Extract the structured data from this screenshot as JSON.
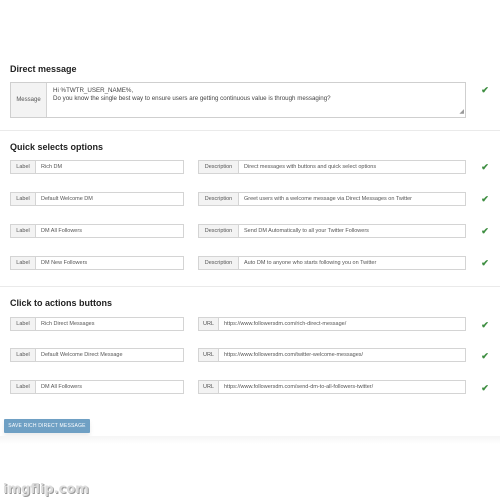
{
  "direct_message": {
    "title": "Direct message",
    "addon": "Message",
    "line1": "Hi %TWTR_USER_NAME%,",
    "line2": "Do you know the single best way to ensure users are getting continuous value is through messaging?"
  },
  "quick_selects": {
    "title": "Quick selects options",
    "label_addon": "Label",
    "description_addon": "Description",
    "rows": [
      {
        "label": "Rich DM",
        "description": "Direct messages with buttons and quick select options"
      },
      {
        "label": "Default Welcome DM",
        "description": "Greet users with a welcome message via Direct Messages on Twitter"
      },
      {
        "label": "DM All Followers",
        "description": "Send DM Automatically to all your Twitter Followers"
      },
      {
        "label": "DM New Followers",
        "description": "Auto DM to anyone who starts following you on Twitter"
      }
    ]
  },
  "action_buttons": {
    "title": "Click to actions buttons",
    "label_addon": "Label",
    "url_addon": "URL",
    "rows": [
      {
        "label": "Rich Direct Messages",
        "url": "https://www.followersdm.com/rich-direct-message/"
      },
      {
        "label": "Default Welcome Direct Message",
        "url": "https://www.followersdm.com/twitter-welcome-messages/"
      },
      {
        "label": "DM All Followers",
        "url": "https://www.followersdm.com/send-dm-to-all-followers-twitter/"
      }
    ]
  },
  "save_button_label": "SAVE RICH DIRECT MESSAGE",
  "check_glyph": "✔",
  "resize_glyph": "◢",
  "watermark": "imgflip.com",
  "colors": {
    "check": "#3e8e41",
    "button": "#6fa0c4"
  }
}
